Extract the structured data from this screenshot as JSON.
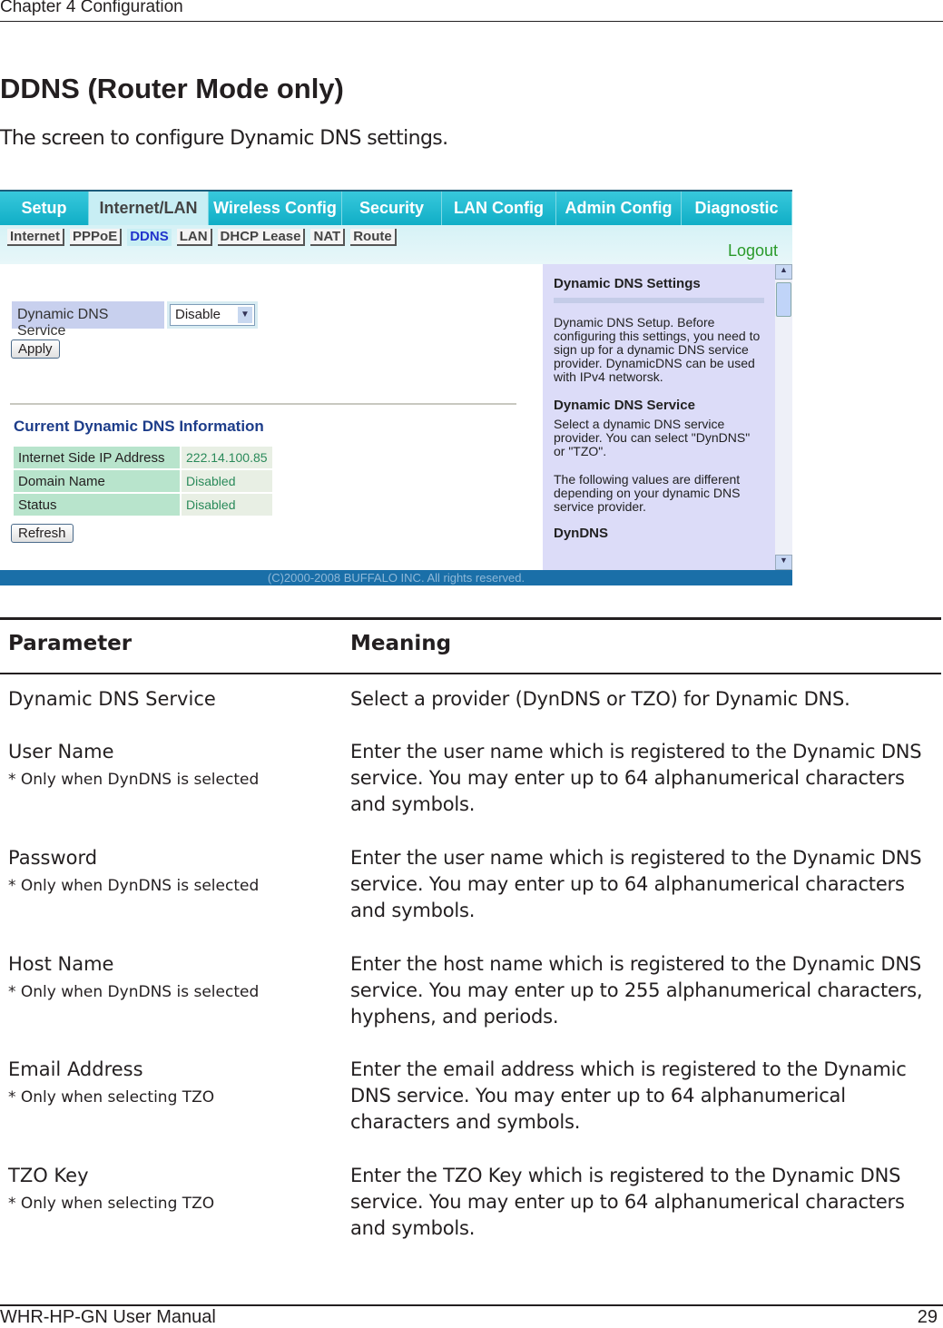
{
  "header": {
    "chapter": "Chapter 4  Configuration"
  },
  "title": "DDNS (Router Mode only)",
  "subtitle": "The screen to configure Dynamic DNS settings.",
  "screenshot": {
    "tabs": [
      "Setup",
      "Internet/LAN",
      "Wireless Config",
      "Security",
      "LAN Config",
      "Admin Config",
      "Diagnostic"
    ],
    "active_tab": "Internet/LAN",
    "subtabs": [
      "Internet",
      "PPPoE",
      "DDNS",
      "LAN",
      "DHCP Lease",
      "NAT",
      "Route"
    ],
    "active_subtab": "DDNS",
    "logout": "Logout",
    "service_label": "Dynamic DNS Service",
    "service_value": "Disable",
    "apply": "Apply",
    "info_title": "Current Dynamic DNS Information",
    "info_rows": [
      {
        "k": "Internet Side IP Address",
        "v": "222.14.100.85"
      },
      {
        "k": "Domain Name",
        "v": "Disabled"
      },
      {
        "k": "Status",
        "v": "Disabled"
      }
    ],
    "refresh": "Refresh",
    "help_title": "Dynamic DNS Settings",
    "help_p1": "Dynamic DNS Setup. Before configuring this settings, you need to sign up for a dynamic DNS service provider. DynamicDNS can be used with IPv4 networsk.",
    "help_title2": "Dynamic DNS Service",
    "help_p2": "Select a dynamic DNS service provider. You can select \"DynDNS\" or \"TZO\".",
    "help_p3": "The following values are different depending on your dynamic DNS service provider.",
    "help_title3": "DynDNS",
    "copyright": "(C)2000-2008 BUFFALO INC. All rights reserved."
  },
  "table": {
    "headers": [
      "Parameter",
      "Meaning"
    ],
    "rows": [
      {
        "param": "Dynamic DNS Service",
        "note": "",
        "meaning": "Select a provider (DynDNS or TZO) for Dynamic DNS."
      },
      {
        "param": "User Name",
        "note": "* Only when DynDNS is selected",
        "meaning": "Enter the user name which is registered to the Dynamic DNS service. You may enter up to 64 alphanumerical characters and symbols."
      },
      {
        "param": "Password",
        "note": "* Only when DynDNS is selected",
        "meaning": "Enter the user name which is registered to the Dynamic DNS service. You may enter up to 64 alphanumerical characters and symbols."
      },
      {
        "param": "Host Name",
        "note": "* Only when DynDNS is selected",
        "meaning": "Enter the host name which is registered to the Dynamic DNS service. You may enter up to 255 alphanumerical characters, hyphens, and periods."
      },
      {
        "param": "Email Address",
        "note": "* Only when selecting TZO",
        "meaning": "Enter the email address which is registered to the Dynamic DNS service. You may enter up to 64 alphanumerical characters and symbols."
      },
      {
        "param": "TZO Key",
        "note": "* Only when selecting TZO",
        "meaning": "Enter the TZO Key which is registered to the Dynamic DNS service. You may enter up to 64 alphanumerical characters and symbols."
      }
    ]
  },
  "footer": {
    "manual": "WHR-HP-GN User Manual",
    "page": "29"
  }
}
